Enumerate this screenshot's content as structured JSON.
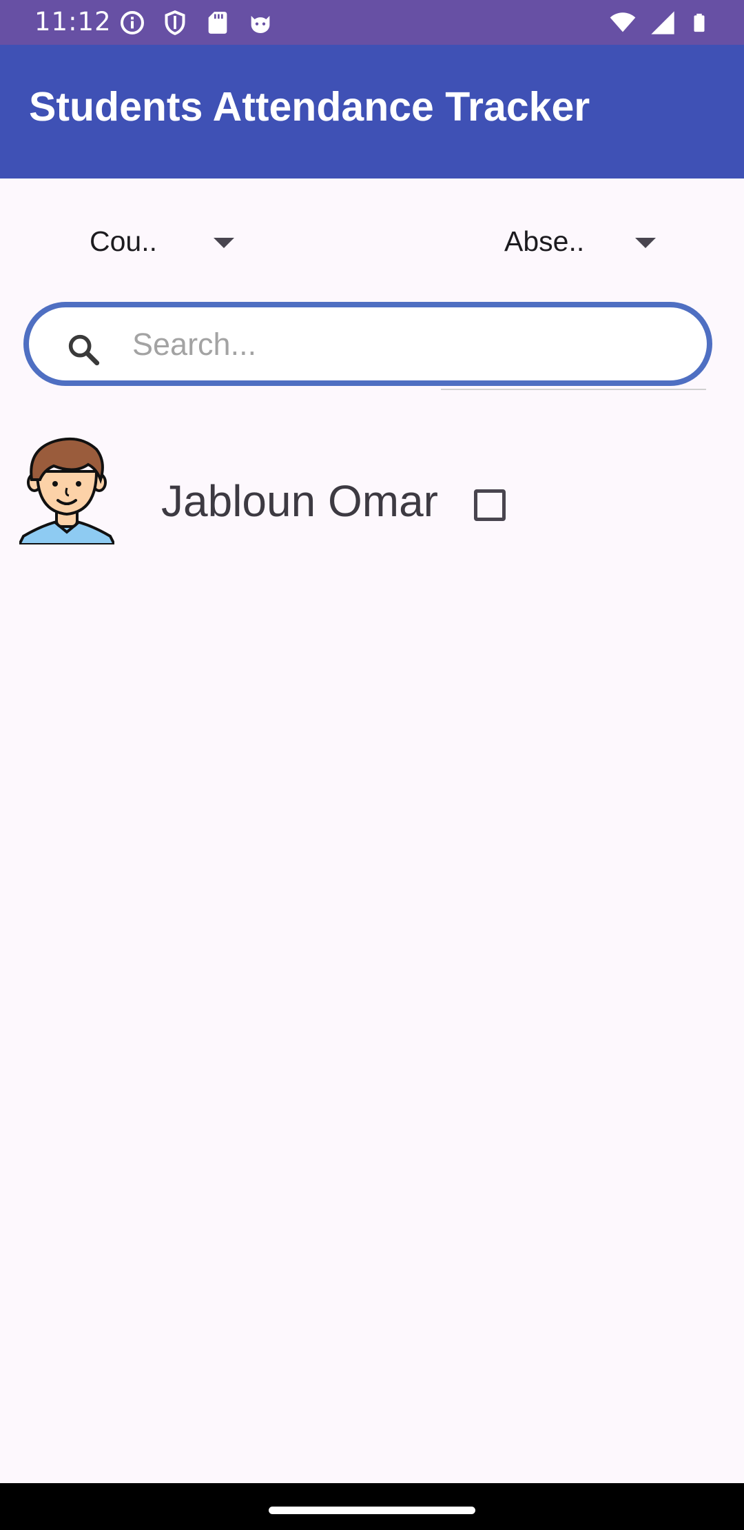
{
  "status_bar": {
    "time": "11:12",
    "left_icons": [
      "info-icon",
      "shield-icon",
      "sd-card-icon",
      "cat-face-icon"
    ],
    "right_icons": [
      "wifi-icon",
      "signal-icon",
      "battery-icon"
    ]
  },
  "app_bar": {
    "title": "Students Attendance Tracker",
    "color": "#3f51b5"
  },
  "filters": {
    "course_spinner_value": "Cou..",
    "absence_spinner_value": "Abse.."
  },
  "search": {
    "placeholder": "Search...",
    "value": "",
    "border_color": "#4f6fc2"
  },
  "students": [
    {
      "name": "Jabloun Omar",
      "avatar": "boy-avatar-icon",
      "checked": false
    }
  ],
  "colors": {
    "status_bar": "#6750a4",
    "background": "#fdf8fd"
  }
}
